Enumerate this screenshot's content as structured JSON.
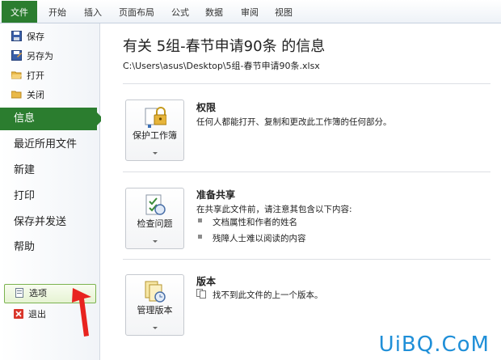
{
  "ribbon": {
    "tabs": [
      "文件",
      "开始",
      "插入",
      "页面布局",
      "公式",
      "数据",
      "审阅",
      "视图"
    ]
  },
  "nav": {
    "save": "保存",
    "save_as": "另存为",
    "open": "打开",
    "close": "关闭",
    "info": "信息",
    "recent": "最近所用文件",
    "new": "新建",
    "print": "打印",
    "save_send": "保存并发送",
    "help": "帮助",
    "options": "选项",
    "exit": "退出"
  },
  "info": {
    "title": "有关 5组-春节申请90条 的信息",
    "path": "C:\\Users\\asus\\Desktop\\5组-春节申请90条.xlsx",
    "permissions": {
      "button": "保护工作簿",
      "heading": "权限",
      "text": "任何人都能打开、复制和更改此工作簿的任何部分。"
    },
    "prepare": {
      "button": "检查问题",
      "heading": "准备共享",
      "text": "在共享此文件前，请注意其包含以下内容:",
      "items": [
        "文档属性和作者的姓名",
        "残障人士难以阅读的内容"
      ]
    },
    "versions": {
      "button": "管理版本",
      "heading": "版本",
      "text": "找不到此文件的上一个版本。"
    }
  },
  "watermark": "UiBQ.CoM",
  "colors": {
    "accent": "#2b7d2f",
    "arrow": "#e8231f",
    "watermark": "#1f8fd8"
  }
}
